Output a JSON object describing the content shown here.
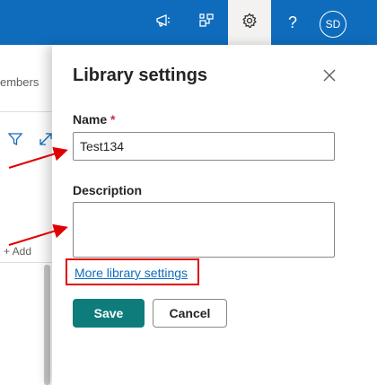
{
  "topbar": {
    "icons": [
      "megaphone-icon",
      "share-icon",
      "gear-icon",
      "help-icon"
    ],
    "help_glyph": "?",
    "avatar_initials": "SD",
    "brand_color": "#0f6cbd"
  },
  "background": {
    "members_text": "embers",
    "add_text": "+ Add",
    "icons": [
      "filter-icon",
      "expand-icon"
    ]
  },
  "panel": {
    "title": "Library settings",
    "name_label": "Name",
    "required_marker": "*",
    "name_value": "Test134",
    "description_label": "Description",
    "description_value": "",
    "more_settings_link": "More library settings",
    "save_label": "Save",
    "cancel_label": "Cancel",
    "accent_color": "#0f7c7c"
  },
  "annotations": {
    "arrow_color": "#e00000",
    "highlight_color": "#e00000"
  }
}
